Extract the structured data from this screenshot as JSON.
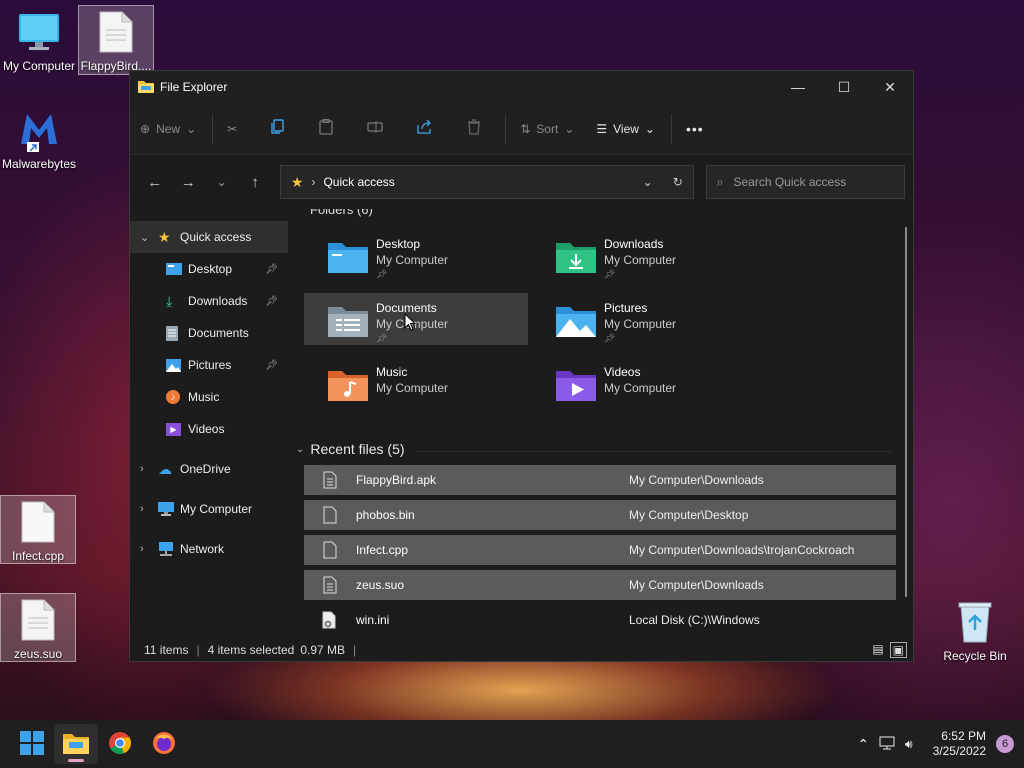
{
  "desktop": {
    "icons": [
      {
        "label": "My Computer"
      },
      {
        "label": "FlappyBird...."
      },
      {
        "label": "Malwarebytes"
      },
      {
        "label": "Infect.cpp"
      },
      {
        "label": "zeus.suo"
      },
      {
        "label": "Recycle Bin"
      }
    ]
  },
  "window": {
    "title": "File Explorer",
    "toolbar": {
      "new_label": "New",
      "sort_label": "Sort",
      "view_label": "View",
      "more_label": "•••"
    },
    "address": {
      "location": "Quick access",
      "search_placeholder": "Search Quick access"
    },
    "sidebar": {
      "items": [
        {
          "label": "Quick access"
        },
        {
          "label": "Desktop"
        },
        {
          "label": "Downloads"
        },
        {
          "label": "Documents"
        },
        {
          "label": "Pictures"
        },
        {
          "label": "Music"
        },
        {
          "label": "Videos"
        },
        {
          "label": "OneDrive"
        },
        {
          "label": "My Computer"
        },
        {
          "label": "Network"
        }
      ]
    },
    "folders_header": "Folders (6)",
    "folders": [
      {
        "name": "Desktop",
        "location": "My Computer"
      },
      {
        "name": "Downloads",
        "location": "My Computer"
      },
      {
        "name": "Documents",
        "location": "My Computer"
      },
      {
        "name": "Pictures",
        "location": "My Computer"
      },
      {
        "name": "Music",
        "location": "My Computer"
      },
      {
        "name": "Videos",
        "location": "My Computer"
      }
    ],
    "recent_header": "Recent files (5)",
    "recent_files": [
      {
        "name": "FlappyBird.apk",
        "path": "My Computer\\Downloads",
        "selected": true
      },
      {
        "name": "phobos.bin",
        "path": "My Computer\\Desktop",
        "selected": true
      },
      {
        "name": "Infect.cpp",
        "path": "My Computer\\Downloads\\trojanCockroach",
        "selected": true
      },
      {
        "name": "zeus.suo",
        "path": "My Computer\\Downloads",
        "selected": true
      },
      {
        "name": "win.ini",
        "path": "Local Disk (C:)\\Windows",
        "selected": false
      }
    ],
    "status": {
      "items": "11 items",
      "selected": "4 items selected",
      "size": "0.97 MB"
    }
  },
  "taskbar": {
    "time": "6:52 PM",
    "date": "3/25/2022",
    "notification_count": "6"
  },
  "colors": {
    "accent_blue": "#3ea2ea",
    "selection_gray": "#5b5b5b",
    "folder_yellow": "#f4c542"
  }
}
